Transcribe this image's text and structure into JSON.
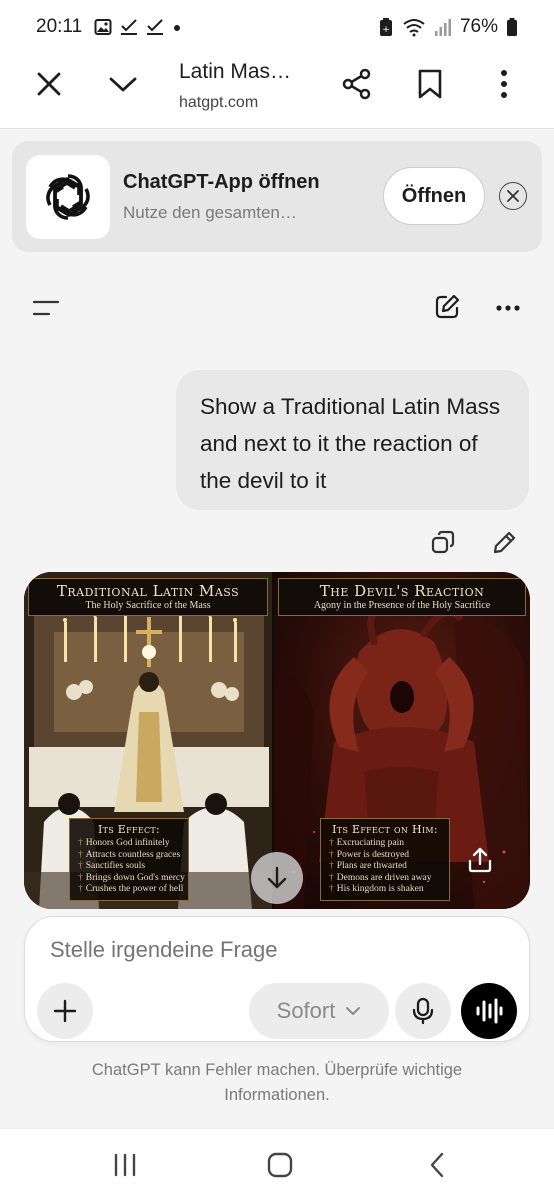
{
  "status_bar": {
    "time": "20:11",
    "battery": "76%"
  },
  "browser": {
    "tab_title": "Latin Mas…",
    "url": "hatgpt.com"
  },
  "app_banner": {
    "title": "ChatGPT-App öffnen",
    "subtitle": "Nutze den gesamten…",
    "open_label": "Öffnen"
  },
  "conversation": {
    "user_message": "Show a Traditional Latin Mass and next to it the reaction of the devil to it",
    "generated_image": {
      "left_panel": {
        "title": "Traditional Latin Mass",
        "subtitle": "The Holy Sacrifice of the Mass",
        "effect_title": "Its Effect:",
        "effects": [
          "Honors God infinitely",
          "Attracts countless graces",
          "Sanctifies souls",
          "Brings down God's mercy",
          "Crushes the power of hell"
        ]
      },
      "right_panel": {
        "title": "The Devil's Reaction",
        "subtitle": "Agony in the Presence of the Holy Sacrifice",
        "effect_title": "Its Effect on Him:",
        "effects": [
          "Excruciating pain",
          "Power is destroyed",
          "Plans are thwarted",
          "Demons are driven away",
          "His kingdom is shaken"
        ]
      }
    }
  },
  "composer": {
    "placeholder": "Stelle irgendeine Frage",
    "mode_label": "Sofort"
  },
  "disclaimer": "ChatGPT kann Fehler machen. Überprüfe wichtige Informationen."
}
